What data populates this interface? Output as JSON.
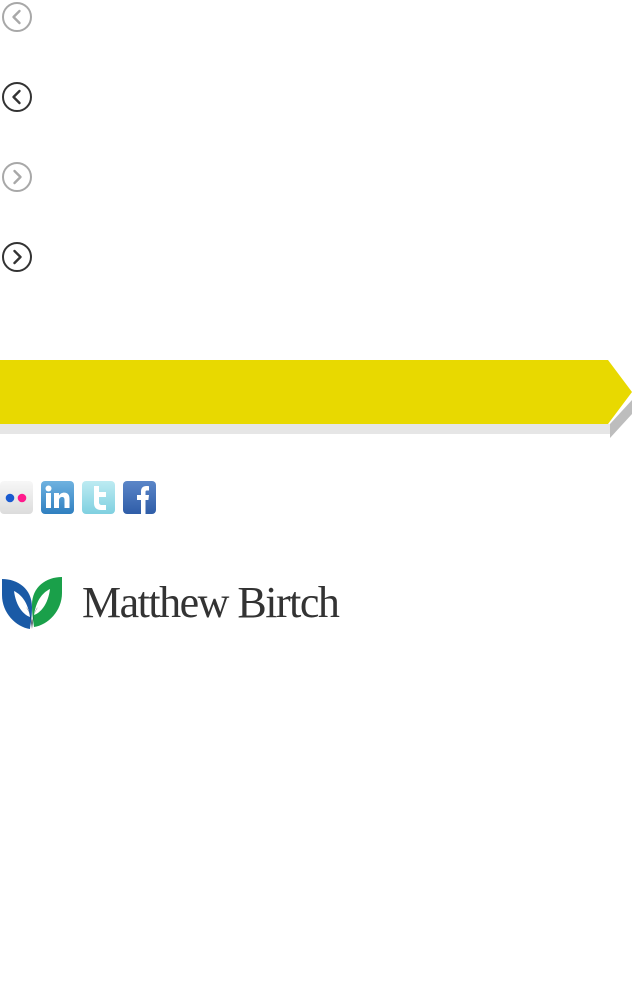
{
  "carousel": {
    "arrows": [
      {
        "icon": "chevron-left-icon",
        "state": "disabled"
      },
      {
        "icon": "chevron-left-icon",
        "state": "active"
      },
      {
        "icon": "chevron-right-icon",
        "state": "disabled"
      },
      {
        "icon": "chevron-right-icon",
        "state": "active"
      }
    ]
  },
  "banner": {
    "color": "#e8d900",
    "text": ""
  },
  "social": {
    "icons": [
      "flickr-icon",
      "linkedin-icon",
      "twitter-icon",
      "facebook-icon"
    ]
  },
  "logo": {
    "text": "Matthew Birtch",
    "colors": {
      "blue": "#1a5aa6",
      "green": "#1aa04a",
      "text": "#333333"
    }
  }
}
